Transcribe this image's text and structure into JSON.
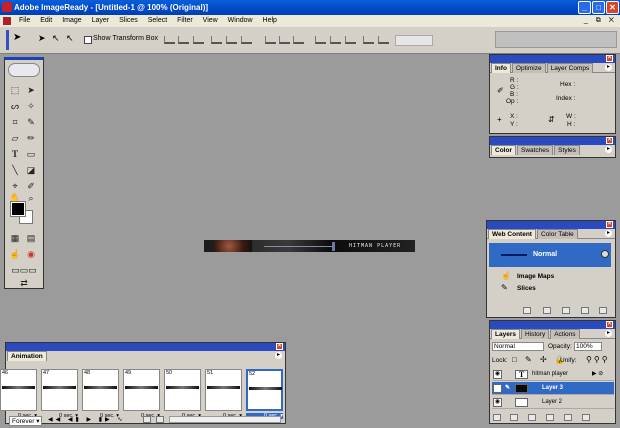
{
  "window": {
    "title": "Adobe ImageReady - [Untitled-1 @ 100% (Original)]",
    "minimize": "_",
    "maximize": "□",
    "close": "✕"
  },
  "menu": {
    "items": [
      "File",
      "Edit",
      "Image",
      "Layer",
      "Slices",
      "Select",
      "Filter",
      "View",
      "Window",
      "Help"
    ],
    "doc_controls": "_ ⧉ ✕"
  },
  "options": {
    "show_transform_box": "Show Transform Box"
  },
  "info_panel": {
    "tabs": [
      "Info",
      "Optimize",
      "Layer Comps"
    ],
    "r": "R :",
    "g": "G :",
    "b": "B :",
    "op": "Op :",
    "hex": "Hex :",
    "index": "Index :",
    "x": "X :",
    "y": "Y :",
    "w": "W :",
    "h": "H :"
  },
  "color_panel": {
    "tabs": [
      "Color",
      "Swatches",
      "Styles"
    ]
  },
  "web_content": {
    "tabs": [
      "Web Content",
      "Color Table"
    ],
    "normal": "Normal",
    "image_maps": "Image Maps",
    "slices": "Slices"
  },
  "canvas": {
    "doc_text": "HITMAN PLAYER"
  },
  "animation": {
    "tab": "Animation",
    "frames": [
      {
        "num": "46",
        "delay": "0 sec. ▾"
      },
      {
        "num": "47",
        "delay": "0 sec. ▾"
      },
      {
        "num": "48",
        "delay": "0 sec. ▾"
      },
      {
        "num": "49",
        "delay": "0 sec. ▾"
      },
      {
        "num": "50",
        "delay": "0 sec. ▾"
      },
      {
        "num": "51",
        "delay": "0 sec. ▾"
      },
      {
        "num": "52",
        "delay": "0 sec. ▾"
      }
    ],
    "loop": "Forever ▾"
  },
  "layers_panel": {
    "tabs": [
      "Layers",
      "History",
      "Actions"
    ],
    "blend_mode": "Normal",
    "opacity_label": "Opacity:",
    "opacity_value": "100%",
    "lock_label": "Lock:",
    "unify_label": "Unify:",
    "layers": [
      {
        "name": "hitman player",
        "type": "text"
      },
      {
        "name": "Layer 3",
        "selected": true
      },
      {
        "name": "Layer 2"
      }
    ]
  }
}
